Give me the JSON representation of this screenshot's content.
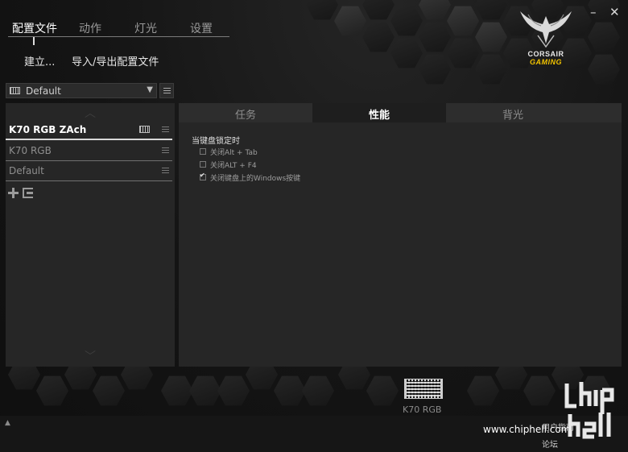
{
  "top_tabs": [
    {
      "label": "配置文件",
      "active": true
    },
    {
      "label": "动作",
      "active": false
    },
    {
      "label": "灯光",
      "active": false
    },
    {
      "label": "设置",
      "active": false
    }
  ],
  "sub_actions": {
    "create_label": "建立...",
    "import_export_label": "导入/导出配置文件"
  },
  "window_controls": {
    "minimize": "–",
    "close": "✕"
  },
  "logo": {
    "line1": "CORSAIR",
    "line2": "GAMING"
  },
  "profile_selector": {
    "value": "Default",
    "caret": "▼"
  },
  "profiles": [
    {
      "label": "K70 RGB ZAch",
      "active": true
    },
    {
      "label": "K70 RGB",
      "active": false
    },
    {
      "label": "Default",
      "active": false
    }
  ],
  "right_tabs": [
    {
      "label": "任务",
      "active": false
    },
    {
      "label": "性能",
      "active": true
    },
    {
      "label": "背光",
      "active": false
    }
  ],
  "performance": {
    "section_title": "当键盘锁定时",
    "options": [
      {
        "label": "关闭Alt + Tab",
        "checked": false
      },
      {
        "label": "关闭ALT + F4",
        "checked": false
      },
      {
        "label": "关闭键盘上的Windows按键",
        "checked": true
      }
    ]
  },
  "device": {
    "label": "K70 RGB"
  },
  "bottom": {
    "guide_label": "用户指南",
    "forum_label": "论坛",
    "collapse": "▲"
  },
  "watermark": {
    "site": "www.chiphell.com",
    "logo_text": "chip hell"
  }
}
